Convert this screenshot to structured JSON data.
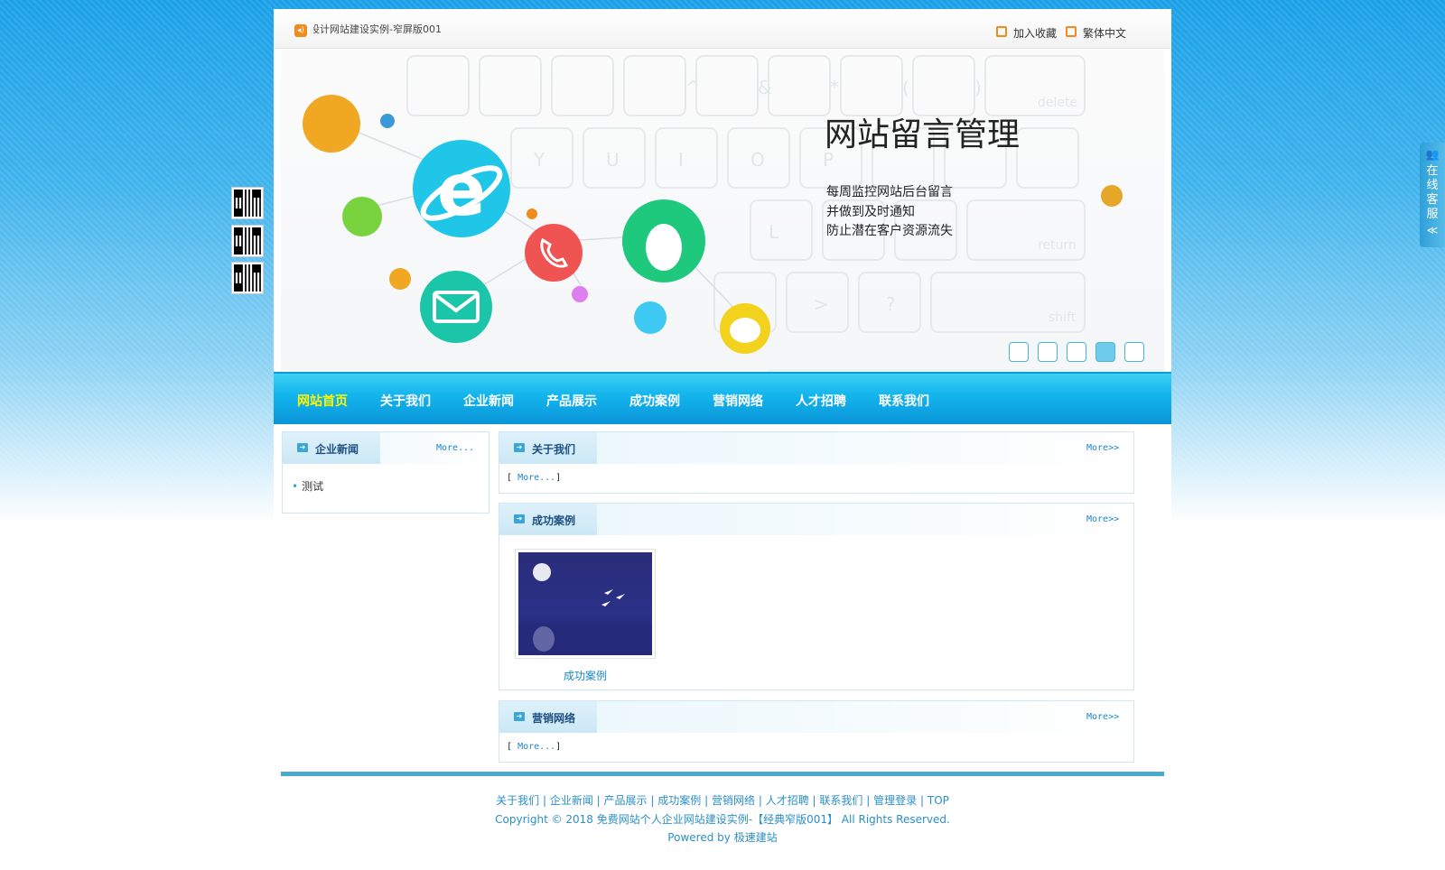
{
  "topbar": {
    "marquee_text": "设计网站建设实例-窄屏版001",
    "favorite_label": "加入收藏",
    "traditional_label": "繁体中文"
  },
  "banner": {
    "title": "网站留言管理",
    "lines": [
      "每周监控网站后台留言",
      "并做到及时通知",
      "防止潜在客户资源流失"
    ],
    "slide_count": 5,
    "active_slide": 4
  },
  "nav": {
    "items": [
      "网站首页",
      "关于我们",
      "企业新闻",
      "产品展示",
      "成功案例",
      "营销网络",
      "人才招聘",
      "联系我们"
    ],
    "current": 0
  },
  "news_box": {
    "title": "企业新闻",
    "more": "More...",
    "items": [
      "测试"
    ]
  },
  "about_box": {
    "title": "关于我们",
    "more": "More>>",
    "bracket_open": "[",
    "bracket_more": "More...",
    "bracket_close": "]"
  },
  "cases_box": {
    "title": "成功案例",
    "more": "More>>",
    "items": [
      {
        "caption": "成功案例"
      }
    ]
  },
  "marketing_box": {
    "title": "营销网络",
    "more": "More>>",
    "bracket_open": "[",
    "bracket_more": "More...",
    "bracket_close": "]"
  },
  "footer": {
    "links": [
      "关于我们",
      "企业新闻",
      "产品展示",
      "成功案例",
      "营销网络",
      "人才招聘",
      "联系我们",
      "管理登录",
      "TOP"
    ],
    "separator": "|",
    "copyright": "Copyright © 2018 免费网站个人企业网站建设实例-【经典窄版001】 All Rights Reserved.",
    "powered_prefix": "Powered by",
    "powered_link": "极速建站"
  },
  "service": {
    "label": "在线客服",
    "collapse_icon": "≪"
  },
  "colors": {
    "accent": "#14b6ee",
    "nav_current": "#fff600",
    "link": "#1a86c6",
    "footer_line": "#4aa9cf"
  }
}
